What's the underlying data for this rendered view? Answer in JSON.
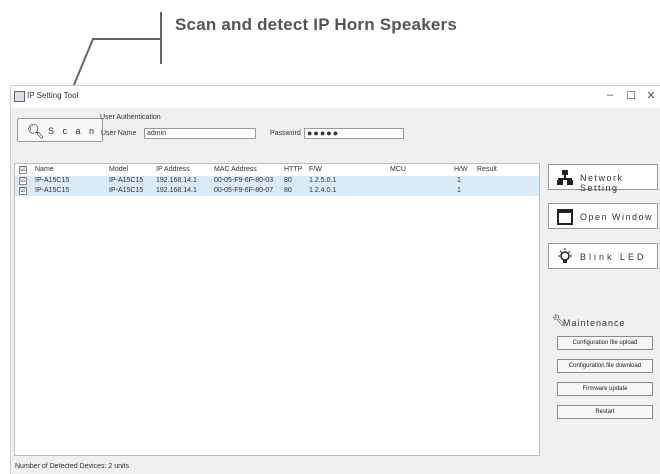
{
  "callout": {
    "text": "Scan and detect IP Horn Speakers"
  },
  "window": {
    "title": "IP Setting Tool",
    "controls": [
      "–",
      "☐",
      "✕"
    ]
  },
  "scan": {
    "label": "S c a n",
    "icon": "search-icon"
  },
  "auth": {
    "title": "User Authentication",
    "username_label": "User Name",
    "username_value": "admin",
    "password_label": "Password",
    "password_value": "●●●●●"
  },
  "table": {
    "columns": [
      "Name",
      "Model",
      "IP Address",
      "MAC Address",
      "HTTP",
      "F/W",
      "MCU",
      "H/W",
      "Result"
    ],
    "rows": [
      {
        "checked": "☑",
        "name": "IP-A15C15",
        "model": "IP-A15C15",
        "ip": "192.168.14.1",
        "mac": "00-05-F9-6F-80-03",
        "http": "80",
        "fw": "1.2.5.0.1",
        "mcu": "",
        "hw": "1",
        "result": ""
      },
      {
        "checked": "☑",
        "name": "IP-A15C15",
        "model": "IP-A15C15",
        "ip": "192.168.14.1",
        "mac": "00-05-F9-6F-80-07",
        "http": "80",
        "fw": "1.2.4.0.1",
        "mcu": "",
        "hw": "1",
        "result": ""
      }
    ]
  },
  "side": {
    "network_setting": "Network Setting",
    "open_window": "Open Window",
    "blink_led": "Blink LED"
  },
  "maintenance": {
    "title": "Maintenance",
    "buttons": [
      "Configuration file upload",
      "Configuration file download",
      "Firmware update",
      "Restart"
    ]
  },
  "status": {
    "text": "Number of Detected Devices: 2 units"
  }
}
